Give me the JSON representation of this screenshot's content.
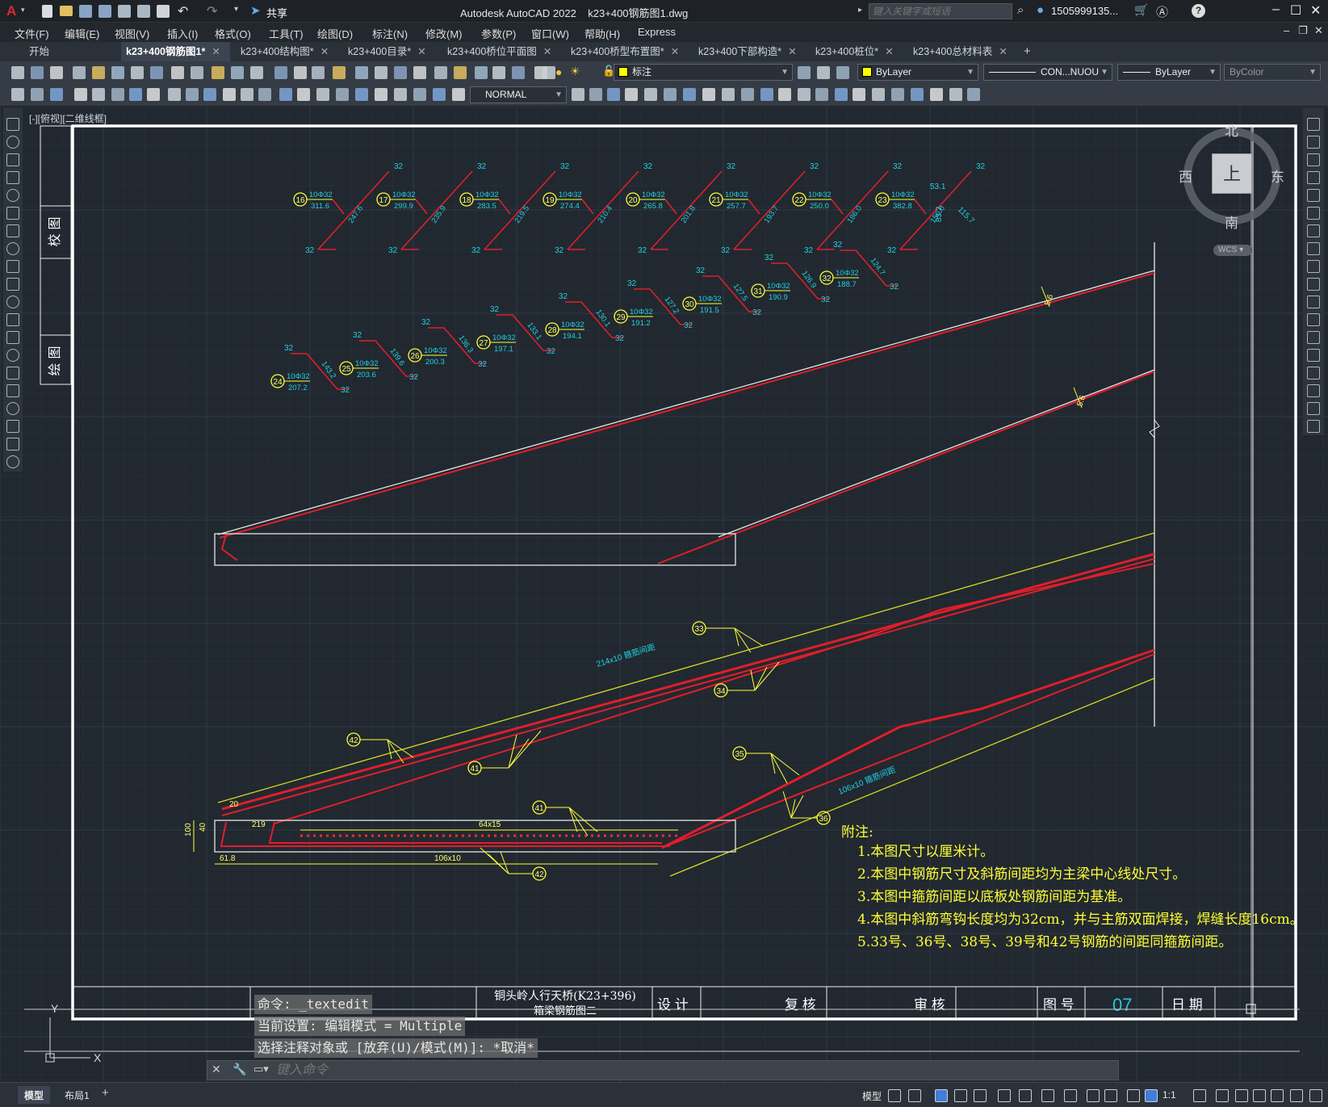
{
  "titlebar": {
    "app_title": "Autodesk AutoCAD 2022",
    "file_name": "k23+400钢筋图1.dwg",
    "share_label": "共享",
    "search_placeholder": "键入关键字或短语",
    "username": "1505999135...",
    "help_label": "?"
  },
  "menu": [
    "文件(F)",
    "编辑(E)",
    "视图(V)",
    "插入(I)",
    "格式(O)",
    "工具(T)",
    "绘图(D)",
    "标注(N)",
    "修改(M)",
    "参数(P)",
    "窗口(W)",
    "帮助(H)",
    "Express"
  ],
  "tabs": [
    {
      "label": "开始",
      "active": false,
      "close": false
    },
    {
      "label": "k23+400钢筋图1*",
      "active": true,
      "close": true
    },
    {
      "label": "k23+400结构图*",
      "active": false,
      "close": true
    },
    {
      "label": "k23+400目录*",
      "active": false,
      "close": true
    },
    {
      "label": "k23+400桥位平面图",
      "active": false,
      "close": true
    },
    {
      "label": "k23+400桥型布置图*",
      "active": false,
      "close": true
    },
    {
      "label": "k23+400下部构造*",
      "active": false,
      "close": true
    },
    {
      "label": "k23+400桩位*",
      "active": false,
      "close": true
    },
    {
      "label": "k23+400总材料表",
      "active": false,
      "close": true
    }
  ],
  "toolbar": {
    "layer_value": "标注",
    "color_value": "ByLayer",
    "linetype_value": "CON...NUOU",
    "lineweight_value": "ByLayer",
    "plotstyle_value": "ByColor",
    "dimstyle_value": "NORMAL"
  },
  "viewport": {
    "label": "[-][俯视][二维线框]",
    "viewcube": {
      "north": "北",
      "south": "南",
      "east": "东",
      "west": "西",
      "top": "上",
      "wcs": "WCS"
    }
  },
  "drawing": {
    "side_labels": [
      "校 图",
      "绘 图"
    ],
    "notes_title": "附注:",
    "notes": [
      "1.本图尺寸以厘米计。",
      "2.本图中钢筋尺寸及斜筋间距均为主梁中心线处尺寸。",
      "3.本图中箍筋间距以底板处钢筋间距为基准。",
      "4.本图中斜筋弯钩长度均为32cm，并与主筋双面焊接，焊缝长度16cm。",
      "5.33号、36号、38号、39号和42号钢筋的间距同箍筋间距。"
    ],
    "title_block": {
      "project": "铜头岭人行天桥(K23+396)",
      "drawing": "箱梁钢筋图二",
      "design": "设 计",
      "review": "复 核",
      "audit": "审 核",
      "sheet_no_label": "图 号",
      "sheet_no": "07",
      "date_label": "日 期"
    },
    "row1_bars": [
      {
        "no": "16",
        "spec": "10Φ32",
        "len": "311.6",
        "diag": "247.6"
      },
      {
        "no": "17",
        "spec": "10Φ32",
        "len": "299.9",
        "diag": "235.9"
      },
      {
        "no": "18",
        "spec": "10Φ32",
        "len": "283.5",
        "diag": "219.5"
      },
      {
        "no": "19",
        "spec": "10Φ32",
        "len": "274.4",
        "diag": "210.4"
      },
      {
        "no": "20",
        "spec": "10Φ32",
        "len": "265.8",
        "diag": "201.8"
      },
      {
        "no": "21",
        "spec": "10Φ32",
        "len": "257.7",
        "diag": "193.7"
      },
      {
        "no": "22",
        "spec": "10Φ32",
        "len": "250.0",
        "diag": "186.0"
      },
      {
        "no": "23",
        "spec": "10Φ32",
        "len": "382.8",
        "diag": "150.0"
      }
    ],
    "row1_extra": [
      "53.1",
      "83.2",
      "115.7"
    ],
    "row2_bars": [
      {
        "no": "24",
        "spec": "10Φ32",
        "len": "207.2",
        "diag": "143.2"
      },
      {
        "no": "25",
        "spec": "10Φ32",
        "len": "203.6",
        "diag": "139.6"
      },
      {
        "no": "26",
        "spec": "10Φ32",
        "len": "200.3",
        "diag": "136.3"
      },
      {
        "no": "27",
        "spec": "10Φ32",
        "len": "197.1",
        "diag": "133.1"
      },
      {
        "no": "28",
        "spec": "10Φ32",
        "len": "194.1",
        "diag": "130.1"
      },
      {
        "no": "29",
        "spec": "10Φ32",
        "len": "191.2",
        "diag": "127.2"
      },
      {
        "no": "30",
        "spec": "10Φ32",
        "len": "191.5",
        "diag": "127.5"
      },
      {
        "no": "31",
        "spec": "10Φ32",
        "len": "190.9",
        "diag": "126.9"
      },
      {
        "no": "32",
        "spec": "10Φ32",
        "len": "188.7",
        "diag": "124.7"
      }
    ],
    "hook": "32",
    "dims": {
      "d56a": "5.6",
      "d56b": "5.6",
      "spacing_a": "214x10 箍筋间距",
      "spacing_b": "106x10 箍筋间距",
      "d20": "20",
      "d219": "219",
      "d40": "40",
      "d100": "100",
      "d618": "61.8",
      "d64x15": "64x15",
      "d106x10": "106x10"
    },
    "callouts": [
      "33",
      "34",
      "35",
      "36",
      "41",
      "41",
      "42",
      "42"
    ]
  },
  "command": {
    "history": [
      "命令: _textedit",
      "当前设置: 编辑模式 = Multiple",
      "选择注释对象或 [放弃(U)/模式(M)]: *取消*"
    ],
    "placeholder": "键入命令"
  },
  "ucs": {
    "x": "X",
    "y": "Y"
  },
  "status": {
    "layout_tabs": [
      "模型",
      "布局1"
    ],
    "model_label": "模型",
    "scale": "1:1"
  }
}
